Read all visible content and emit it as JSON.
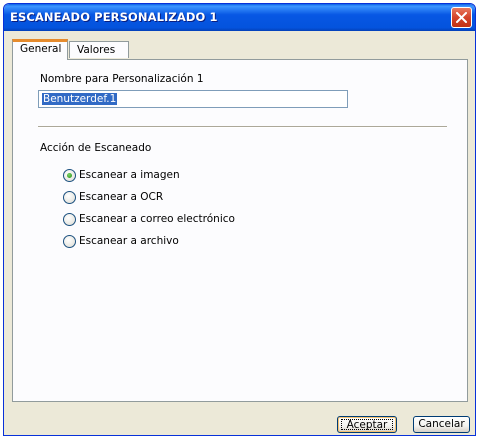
{
  "window": {
    "title": "ESCANEADO PERSONALIZADO 1"
  },
  "tabs": [
    {
      "label": "General",
      "active": true
    },
    {
      "label": "Valores",
      "active": false
    }
  ],
  "general": {
    "name_label": "Nombre para Personalización 1",
    "name_value": "Benutzerdef.1",
    "action_label": "Acción de Escaneado",
    "options": [
      {
        "label": "Escanear a imagen",
        "selected": true
      },
      {
        "label": "Escanear a OCR",
        "selected": false
      },
      {
        "label": "Escanear a correo electrónico",
        "selected": false
      },
      {
        "label": "Escanear a archivo",
        "selected": false
      }
    ]
  },
  "footer": {
    "ok_label": "Aceptar",
    "cancel_label": "Cancelar"
  },
  "icons": {
    "close": "close-icon"
  },
  "colors": {
    "titlebar": "#0453dd",
    "dialog_bg": "#ece9d8",
    "tab_accent": "#e68b2c",
    "selection": "#316ac5",
    "close_button": "#d4432a"
  }
}
